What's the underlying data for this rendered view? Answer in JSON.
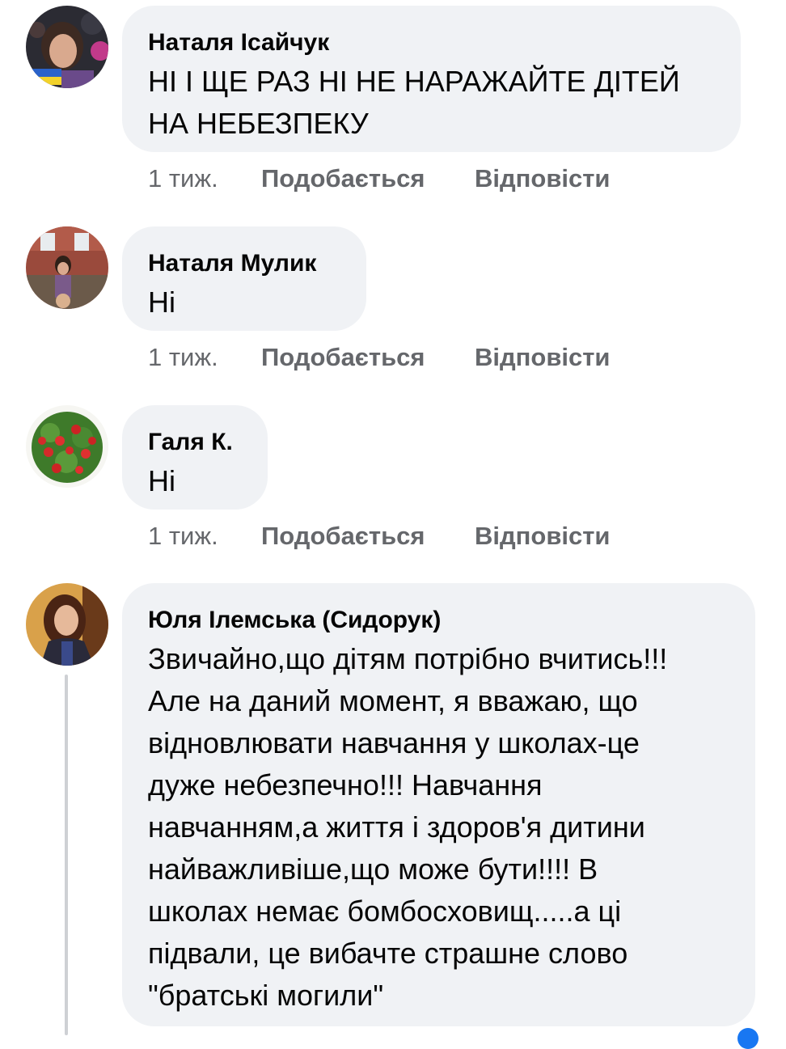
{
  "comments": [
    {
      "author": "Наталя Ісайчук",
      "lines": [
        "НІ І ЩЕ РАЗ НІ НЕ НАРАЖАЙТЕ ДІТЕЙ",
        "НА НЕБЕЗПЕКУ"
      ],
      "time": "1 тиж.",
      "like_label": "Подобається",
      "reply_label": "Відповісти",
      "avatar": "profile-photo-woman-flag"
    },
    {
      "author": "Наталя Мулик",
      "lines": [
        "Ні"
      ],
      "time": "1 тиж.",
      "like_label": "Подобається",
      "reply_label": "Відповісти",
      "avatar": "profile-photo-child-brick-building"
    },
    {
      "author": "Галя К.",
      "lines": [
        "Ні"
      ],
      "time": "1 тиж.",
      "like_label": "Подобається",
      "reply_label": "Відповісти",
      "avatar": "profile-photo-strawberries"
    },
    {
      "author": "Юля Ілемська (Сидорук)",
      "lines": [
        "Звичайно,що дітям потрібно вчитись!!!",
        "Але на даний момент, я вважаю, що",
        "відновлювати навчання у школах-це",
        "дуже небезпечно!!! Навчання",
        "навчанням,а життя і здоров'я дитини",
        "найважливіше,що може бути!!!! В",
        "школах немає бомбосховищ.....а ці",
        "підвали, це вибачте страшне слово",
        "\"братські могили\""
      ],
      "avatar": "profile-photo-woman-graduate"
    }
  ],
  "colors": {
    "bubble": "#f0f2f5",
    "text": "#050505",
    "meta": "#65676b",
    "thread_line": "#ced0d4",
    "accent": "#1877f2"
  }
}
